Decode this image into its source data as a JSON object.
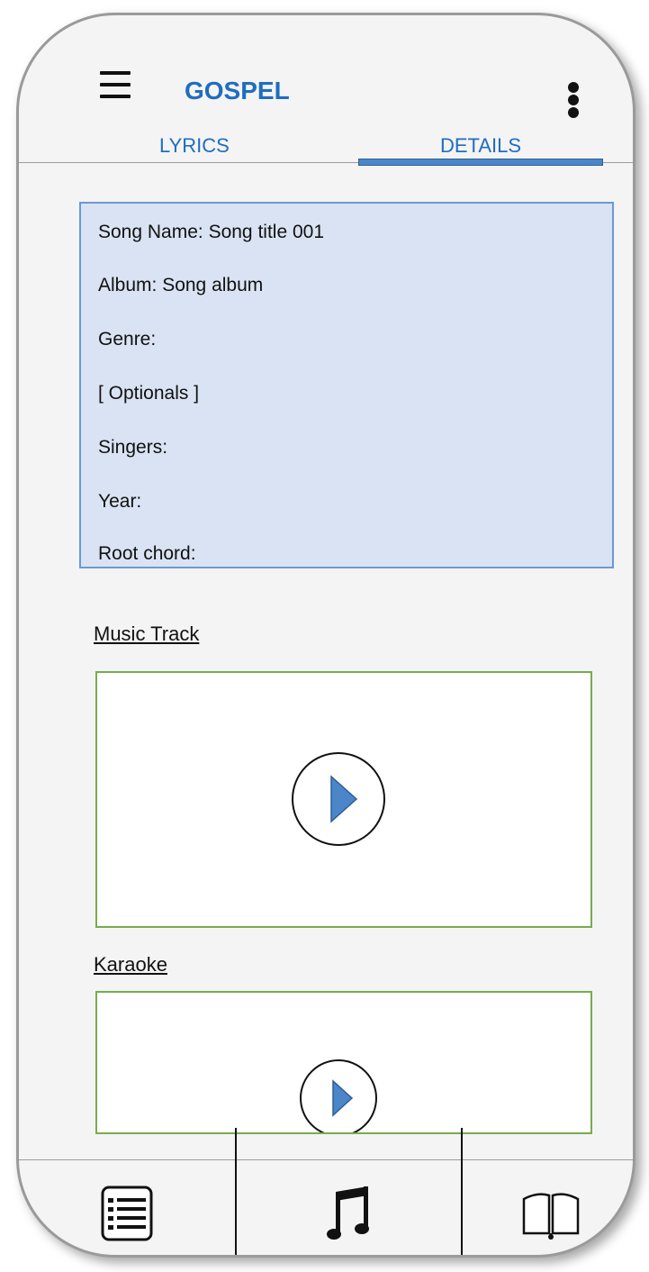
{
  "app": {
    "title": "GOSPEL"
  },
  "icons": {
    "menu": "hamburger-menu-icon",
    "more": "more-vert-icon",
    "play": "play-icon",
    "list": "list-icon",
    "music": "music-note-icon",
    "book": "open-book-icon"
  },
  "tabs": {
    "lyrics": "LYRICS",
    "details": "DETAILS",
    "active": "DETAILS"
  },
  "details": {
    "song_name": "Song Name: Song title 001",
    "album": "Album: Song album",
    "genre": "Genre:",
    "optionals": "[ Optionals ]",
    "singers": "Singers:",
    "year": "Year:",
    "root_chord": "Root chord:"
  },
  "sections": {
    "music_track": "Music Track",
    "karaoke": "Karaoke"
  },
  "colors": {
    "accent": "#1f6dc0",
    "tab_indicator": "#4a86c8",
    "details_background": "#dae3f3",
    "details_border": "#6b99d2",
    "media_border": "#77ab4c",
    "play_triangle": "#4a86c8"
  }
}
